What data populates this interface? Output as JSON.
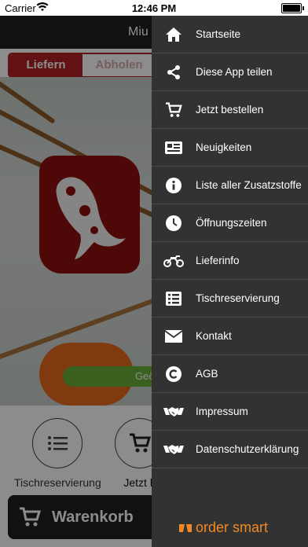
{
  "status_bar": {
    "carrier": "Carrier",
    "time": "12:46 PM"
  },
  "header": {
    "title": "Miu"
  },
  "delivery_toggle": {
    "deliver_label": "Liefern",
    "pickup_label": "Abholen"
  },
  "hero": {
    "button_label": "Geö"
  },
  "actions": [
    {
      "label": "Tischreservierung",
      "icon": "list-icon"
    },
    {
      "label": "Jetzt b",
      "icon": "cart-icon"
    }
  ],
  "cart_button": {
    "label": "Warenkorb"
  },
  "menu": {
    "items": [
      {
        "label": "Startseite",
        "icon": "home-icon"
      },
      {
        "label": "Diese App teilen",
        "icon": "share-icon"
      },
      {
        "label": "Jetzt bestellen",
        "icon": "cart-icon"
      },
      {
        "label": "Neuigkeiten",
        "icon": "news-icon"
      },
      {
        "label": "Liste aller Zusatzstoffe",
        "icon": "info-icon"
      },
      {
        "label": "Öffnungszeiten",
        "icon": "clock-icon"
      },
      {
        "label": "Lieferinfo",
        "icon": "motorcycle-icon"
      },
      {
        "label": "Tischreservierung",
        "icon": "list-icon"
      },
      {
        "label": "Kontakt",
        "icon": "envelope-icon"
      },
      {
        "label": "AGB",
        "icon": "copyright-icon"
      },
      {
        "label": "Impressum",
        "icon": "handshake-icon"
      },
      {
        "label": "Datenschutzerklärung",
        "icon": "handshake-icon"
      }
    ]
  },
  "brand": {
    "name": "order smart"
  },
  "colors": {
    "accent_red": "#b22222",
    "drawer_bg": "#323232",
    "brand_orange": "#f08a24",
    "open_green": "#6bb13a"
  }
}
